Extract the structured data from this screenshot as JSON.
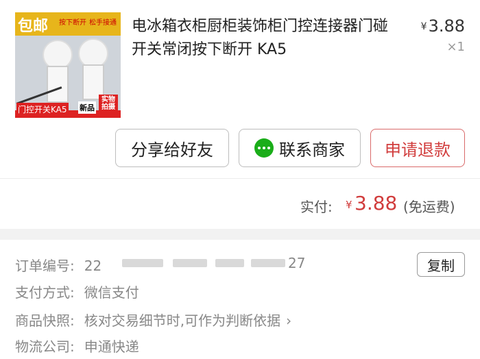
{
  "product": {
    "thumbnail": {
      "badge": "包邮",
      "tag_left": "按下断开",
      "tag_right": "松手接通",
      "caption": "门控开关KA5",
      "new_label": "新品",
      "real_label": "实物拍摄"
    },
    "title": "电冰箱衣柜厨柜装饰柜门控连接器门碰开关常闭按下断开 KA5",
    "currency_symbol": "¥",
    "price": "3.88",
    "quantity": "×1"
  },
  "actions": {
    "share_label": "分享给好友",
    "contact_label": "联系商家",
    "refund_label": "申请退款"
  },
  "payment": {
    "label": "实付:",
    "currency_symbol": "¥",
    "amount": "3.88",
    "note": "(免运费)"
  },
  "order_info": {
    "order_no_label": "订单编号:",
    "order_no_visible_prefix": "22",
    "order_no_visible_suffix": "27",
    "copy_label": "复制",
    "pay_method_label": "支付方式:",
    "pay_method_value": "微信支付",
    "snapshot_label": "商品快照:",
    "snapshot_value": "核对交易细节时,可作为判断依据",
    "logistics_label": "物流公司:",
    "logistics_value": "申通快递"
  },
  "colors": {
    "accent_red": "#d13c3c",
    "wechat_green": "#1aad19"
  },
  "icons": {
    "wechat": "wechat-icon",
    "chevron": "chevron-right-icon"
  }
}
